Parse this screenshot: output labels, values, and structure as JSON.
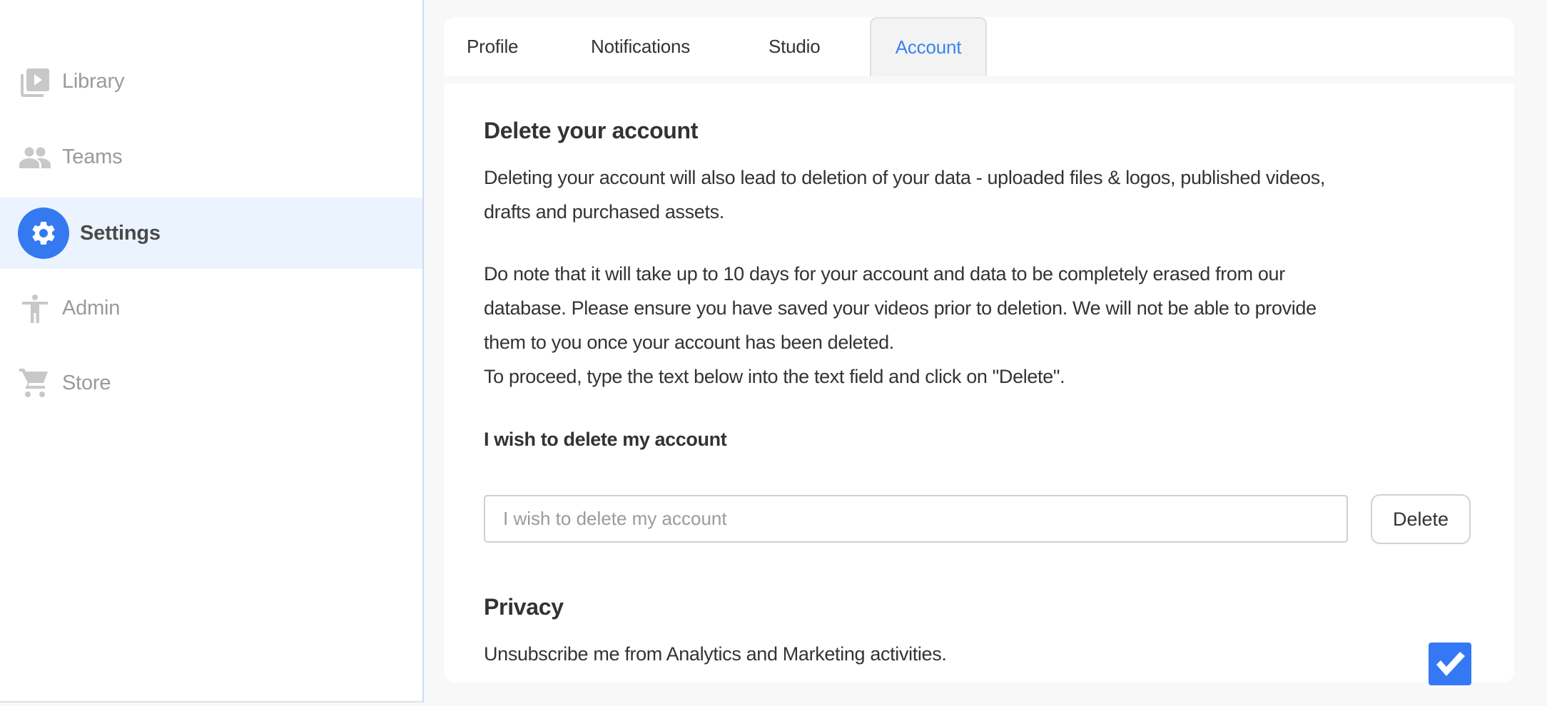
{
  "sidebar": {
    "items": [
      {
        "label": "Library",
        "icon": "video-library-icon",
        "active": false
      },
      {
        "label": "Teams",
        "icon": "people-icon",
        "active": false
      },
      {
        "label": "Settings",
        "icon": "gear-icon",
        "active": true
      },
      {
        "label": "Admin",
        "icon": "accessibility-person-icon",
        "active": false
      },
      {
        "label": "Store",
        "icon": "shopping-cart-icon",
        "active": false
      }
    ]
  },
  "tabs": [
    {
      "label": "Profile",
      "active": false
    },
    {
      "label": "Notifications",
      "active": false
    },
    {
      "label": "Studio",
      "active": false
    },
    {
      "label": "Account",
      "active": true
    }
  ],
  "account": {
    "delete_heading": "Delete your account",
    "para1_lines": [
      "Deleting your account will also lead to deletion of your data - uploaded files & logos, published videos,",
      "drafts and purchased assets."
    ],
    "para2_lines": [
      "Do note that it will take up to 10 days for your account and data to be completely erased from our",
      "database. Please ensure you have saved your videos prior to deletion. We will not be able to provide",
      "them to you once your account has been deleted.",
      "To proceed, type the text below into the text field and click on \"Delete\"."
    ],
    "confirm_phrase": "I wish to delete my account",
    "input_value": "",
    "input_placeholder": "I wish to delete my account",
    "delete_button_label": "Delete"
  },
  "privacy": {
    "heading": "Privacy",
    "unsubscribe_label": "Unsubscribe me from Analytics and Marketing activities.",
    "unsubscribe_checked": true
  },
  "colors": {
    "accent": "#3479f0",
    "active_row_bg": "#ebf3fe",
    "checkbox": "#3478f6"
  }
}
